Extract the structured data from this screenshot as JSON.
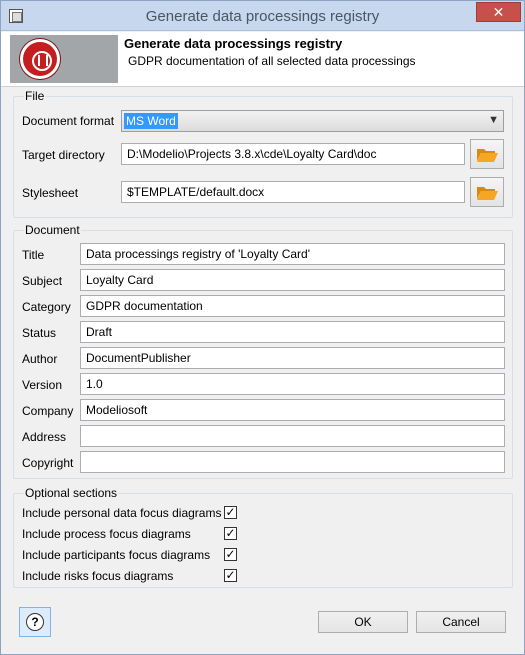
{
  "window": {
    "title": "Generate data processings registry",
    "close_label": "✕"
  },
  "banner": {
    "title": "Generate data processings registry",
    "subtitle": "GDPR documentation of all selected data processings"
  },
  "file": {
    "legend": "File",
    "format_label": "Document format",
    "format_value": "MS Word",
    "target_label": "Target directory",
    "target_value": "D:\\Modelio\\Projects 3.8.x\\cde\\Loyalty Card\\doc",
    "stylesheet_label": "Stylesheet",
    "stylesheet_value": "$TEMPLATE/default.docx"
  },
  "document": {
    "legend": "Document",
    "fields": [
      {
        "label": "Title",
        "value": "Data processings registry of 'Loyalty Card'"
      },
      {
        "label": "Subject",
        "value": "Loyalty Card"
      },
      {
        "label": "Category",
        "value": "GDPR documentation"
      },
      {
        "label": "Status",
        "value": "Draft"
      },
      {
        "label": "Author",
        "value": "DocumentPublisher"
      },
      {
        "label": "Version",
        "value": "1.0"
      },
      {
        "label": "Company",
        "value": "Modeliosoft"
      },
      {
        "label": "Address",
        "value": ""
      },
      {
        "label": "Copyright",
        "value": ""
      }
    ]
  },
  "optional": {
    "legend": "Optional sections",
    "items": [
      {
        "label": "Include personal data focus diagrams",
        "checked": "✓"
      },
      {
        "label": "Include process focus diagrams",
        "checked": "✓"
      },
      {
        "label": "Include participants focus diagrams",
        "checked": "✓"
      },
      {
        "label": "Include risks focus diagrams",
        "checked": "✓"
      }
    ]
  },
  "buttons": {
    "help": "?",
    "ok": "OK",
    "cancel": "Cancel"
  },
  "colors": {
    "titlebar": "#c6d7ee",
    "close": "#c7504a",
    "selection": "#3399ff",
    "folder": "#f5a623"
  },
  "icons": [
    "app-icon",
    "close-icon",
    "modelio-logo-icon",
    "folder-icon",
    "folder-icon",
    "chevron-down-icon",
    "help-icon"
  ]
}
